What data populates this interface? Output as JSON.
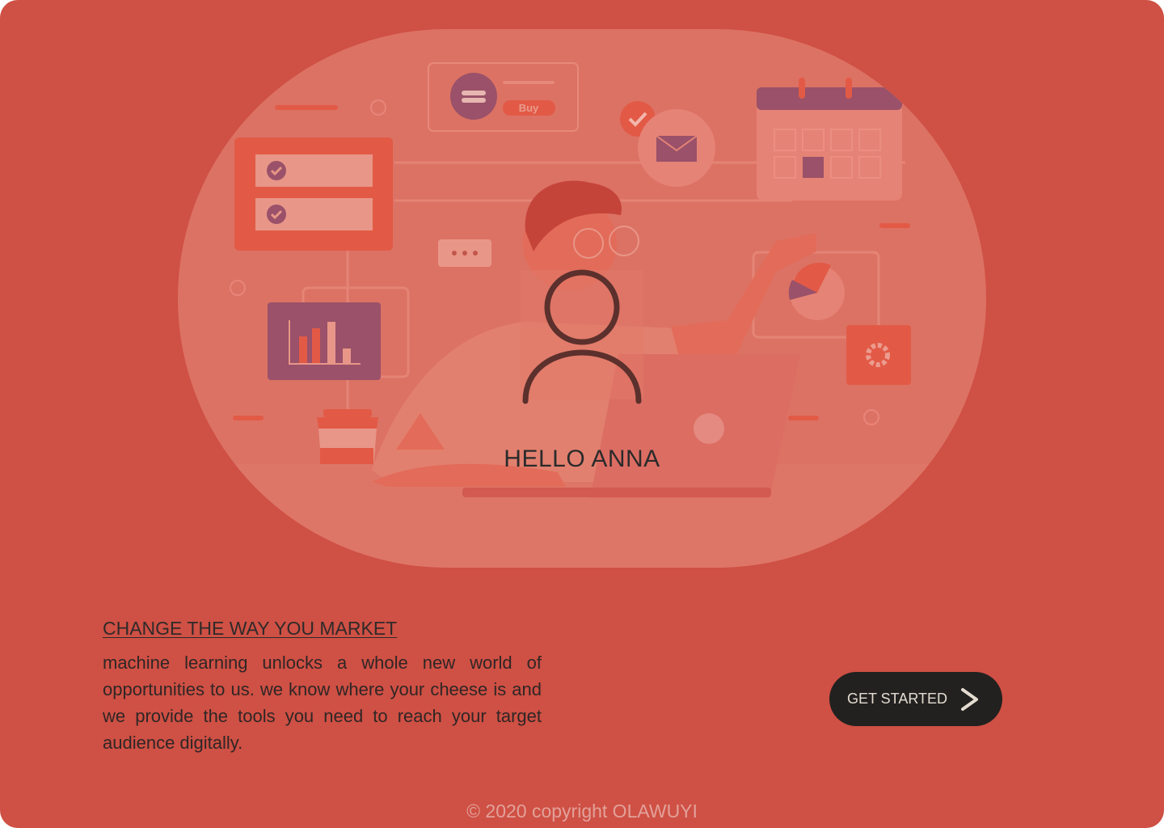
{
  "hero": {
    "greeting": "HELLO ANNA",
    "avatar_icon": "user-icon",
    "illustration": {
      "buy_button_label": "Buy",
      "icons": [
        "burger-icon",
        "check-icon",
        "mail-icon",
        "calendar-icon",
        "chat-bubble-icon",
        "bar-chart-icon",
        "pie-chart-icon",
        "gear-icon",
        "coffee-cup-icon",
        "laptop-icon"
      ]
    }
  },
  "content": {
    "headline": "CHANGE THE WAY YOU MARKET",
    "description": "machine learning unlocks a whole new world of opportunities to us. we know where your cheese is and we provide the tools you need to reach your target audience digitally."
  },
  "cta": {
    "label": "GET STARTED",
    "icon": "chevron-right-icon"
  },
  "footer": {
    "copyright": "© 2020 copyright OLAWUYI"
  },
  "colors": {
    "background": "#cf5044",
    "hero_background": "#dc7264",
    "button": "#222120",
    "button_text": "#e4dcd0",
    "accent_purple": "#9a5169"
  }
}
